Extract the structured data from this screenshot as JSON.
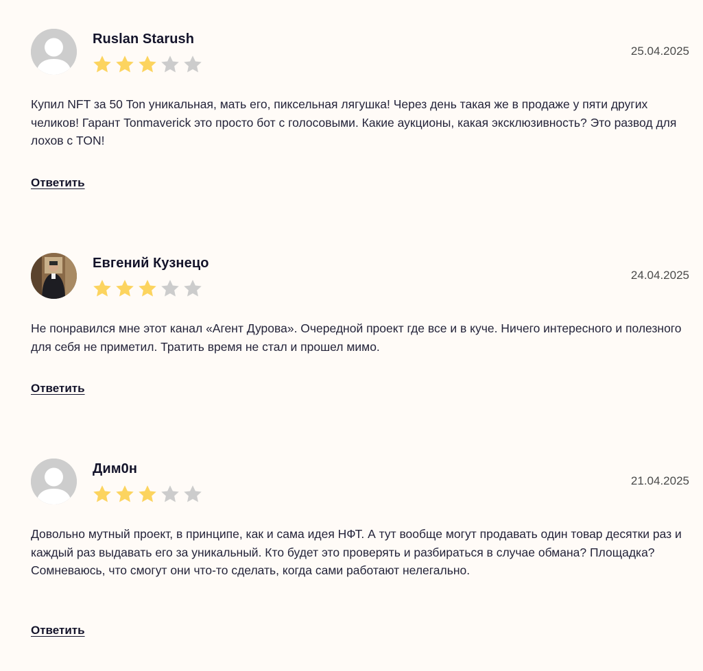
{
  "reviews": [
    {
      "author": "Ruslan Starush",
      "date": "25.04.2025",
      "rating": 3,
      "max_rating": 5,
      "avatar": "default-avatar",
      "text": "Купил NFT за 50 Ton уникальная, мать его, пиксельная лягушка! Через день такая же в продаже у пяти других челиков! Гарант Tonmaverick это просто бот с голосовыми. Какие аукционы, какая эксклюзивность? Это развод для лохов с TON!",
      "reply_label": "Ответить"
    },
    {
      "author": "Евгений Кузнецо",
      "date": "24.04.2025",
      "rating": 3,
      "max_rating": 5,
      "avatar": "photo-avatar",
      "text": "Не понравился мне этот канал «Агент Дурова». Очередной проект где все и в куче. Ничего интересного и полезного для себя не приметил. Тратить время не стал и прошел мимо.",
      "reply_label": "Ответить"
    },
    {
      "author": "Дим0н",
      "date": "21.04.2025",
      "rating": 3,
      "max_rating": 5,
      "avatar": "default-avatar",
      "text": "Довольно мутный проект, в принципе, как и сама идея НФТ. А тут вообще могут продавать один товар десятки раз и каждый раз выдавать его за уникальный. Кто будет это проверять и разбираться в случае обмана? Площадка? Сомневаюсь, что смогут они что-то сделать, когда сами работают нелегально.",
      "reply_label": "Ответить"
    }
  ],
  "colors": {
    "background": "#fffbf7",
    "star_filled": "#fcd45f",
    "star_empty": "#cccccc",
    "avatar_bg": "#cdcdcd"
  }
}
